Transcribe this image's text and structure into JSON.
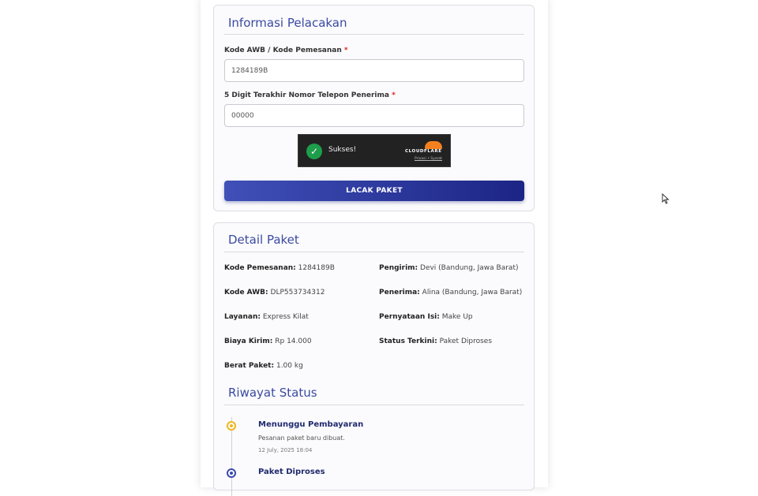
{
  "tracking_form": {
    "title": "Informasi Pelacakan",
    "awb_label": "Kode AWB / Kode Pemesanan",
    "awb_value": "1284189B",
    "phone_label": "5 Digit Terakhir Nomor Telepon Penerima",
    "phone_value": "00000",
    "required_mark": "*",
    "captcha": {
      "status_text": "Sukses!",
      "brand": "CLOUDFLARE",
      "privacy_link": "Privasi",
      "separator": "•",
      "terms_link": "Syarat"
    },
    "submit_label": "LACAK PAKET"
  },
  "package_detail": {
    "title": "Detail Paket",
    "left": [
      {
        "key": "Kode Pemesanan:",
        "value": "1284189B"
      },
      {
        "key": "Kode AWB:",
        "value": "DLP553734312"
      },
      {
        "key": "Layanan:",
        "value": "Express Kilat"
      },
      {
        "key": "Biaya Kirim:",
        "value": "Rp 14.000"
      },
      {
        "key": "Berat Paket:",
        "value": "1.00 kg"
      }
    ],
    "right": [
      {
        "key": "Pengirim:",
        "value": "Devi (Bandung, Jawa Barat)"
      },
      {
        "key": "Penerima:",
        "value": "Alina (Bandung, Jawa Barat)"
      },
      {
        "key": "Pernyataan Isi:",
        "value": "Make Up"
      },
      {
        "key": "Status Terkini:",
        "value": "Paket Diproses"
      }
    ]
  },
  "history": {
    "title": "Riwayat Status",
    "items": [
      {
        "title": "Menunggu Pembayaran",
        "desc": "Pesanan paket baru dibuat.",
        "time": "12 July, 2025 18:04",
        "color": "#f0b51c"
      },
      {
        "title": "Paket Diproses",
        "color": "#3a4ab0"
      }
    ]
  }
}
